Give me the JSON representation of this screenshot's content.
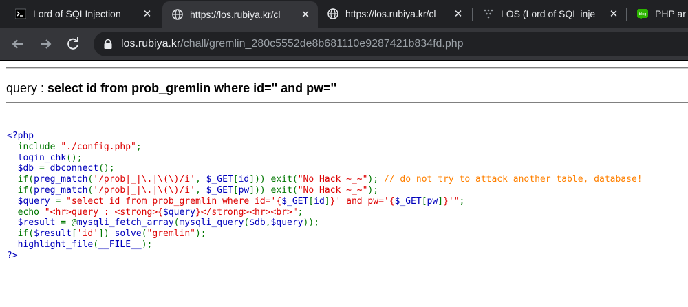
{
  "browser": {
    "tabs": [
      {
        "title": "Lord of SQLInjection",
        "favicon": "terminal-icon",
        "active": false
      },
      {
        "title": "https://los.rubiya.kr/cl",
        "favicon": "globe-icon",
        "active": true
      },
      {
        "title": "https://los.rubiya.kr/cl",
        "favicon": "globe-icon",
        "active": false
      },
      {
        "title": "LOS (Lord of SQL inje",
        "favicon": "dots-icon",
        "active": false
      },
      {
        "title": "PHP ar",
        "favicon": "blog-icon",
        "active": false
      }
    ],
    "address": {
      "host": "los.rubiya.kr",
      "path": "/chall/gremlin_280c5552de8b681110e9287421b834fd.php"
    }
  },
  "page": {
    "query_prefix": "query : ",
    "query_text": "select id from prob_gremlin where id='' and pw=''",
    "source": {
      "open_tag": "<?php",
      "l1_kw": "include ",
      "l1_str": "\"./config.php\"",
      "l1_end": ";",
      "l2_fn": "login_chk",
      "l2_end": "();",
      "l3_var": "$db ",
      "l3_eq": "= ",
      "l3_fn": "dbconnect",
      "l3_end": "();",
      "l4_a": "if(",
      "l4_fn": "preg_match",
      "l4_b": "(",
      "l4_regex": "'/prob|_|\\.|\\(\\)/i'",
      "l4_c": ", ",
      "l4_get": "$_GET",
      "l4_d": "[",
      "l4_key": "id",
      "l4_e": "])) exit(",
      "l4_msg": "\"No Hack ~_~\"",
      "l4_f": "); ",
      "l4_comment": "// do not try to attack another table, database!",
      "l5_a": "if(",
      "l5_fn": "preg_match",
      "l5_b": "(",
      "l5_regex": "'/prob|_|\\.|\\(\\)/i'",
      "l5_c": ", ",
      "l5_get": "$_GET",
      "l5_d": "[",
      "l5_key": "pw",
      "l5_e": "])) exit(",
      "l5_msg": "\"No Hack ~_~\"",
      "l5_f": ");",
      "l6_var": "$query ",
      "l6_eq": "= ",
      "l6_str1": "\"select id from prob_gremlin where id='{",
      "l6_get1": "$_GET",
      "l6_bk1": "[",
      "l6_key1": "id",
      "l6_bk2": "]",
      "l6_str2": "}' and pw='{",
      "l6_get2": "$_GET",
      "l6_bk3": "[",
      "l6_key2": "pw",
      "l6_bk4": "]",
      "l6_str3": "}'\"",
      "l6_end": ";",
      "l7_kw": "echo ",
      "l7_str1": "\"<hr>query : <strong>{",
      "l7_var": "$query",
      "l7_str2": "}</strong><hr><br>\"",
      "l7_end": ";",
      "l8_var": "$result ",
      "l8_eq": "= @",
      "l8_fn1": "mysqli_fetch_array",
      "l8_b": "(",
      "l8_fn2": "mysqli_query",
      "l8_c": "(",
      "l8_args": "$db",
      "l8_comma": ",",
      "l8_q": "$query",
      "l8_end": "));",
      "l9_a": "if(",
      "l9_var": "$result",
      "l9_b": "[",
      "l9_key": "'id'",
      "l9_c": "]) ",
      "l9_fn": "solve",
      "l9_d": "(",
      "l9_str": "\"gremlin\"",
      "l9_end": ");",
      "l10_fn": "highlight_file",
      "l10_a": "(",
      "l10_const": "__FILE__",
      "l10_end": ");",
      "close_tag": "?>"
    }
  }
}
